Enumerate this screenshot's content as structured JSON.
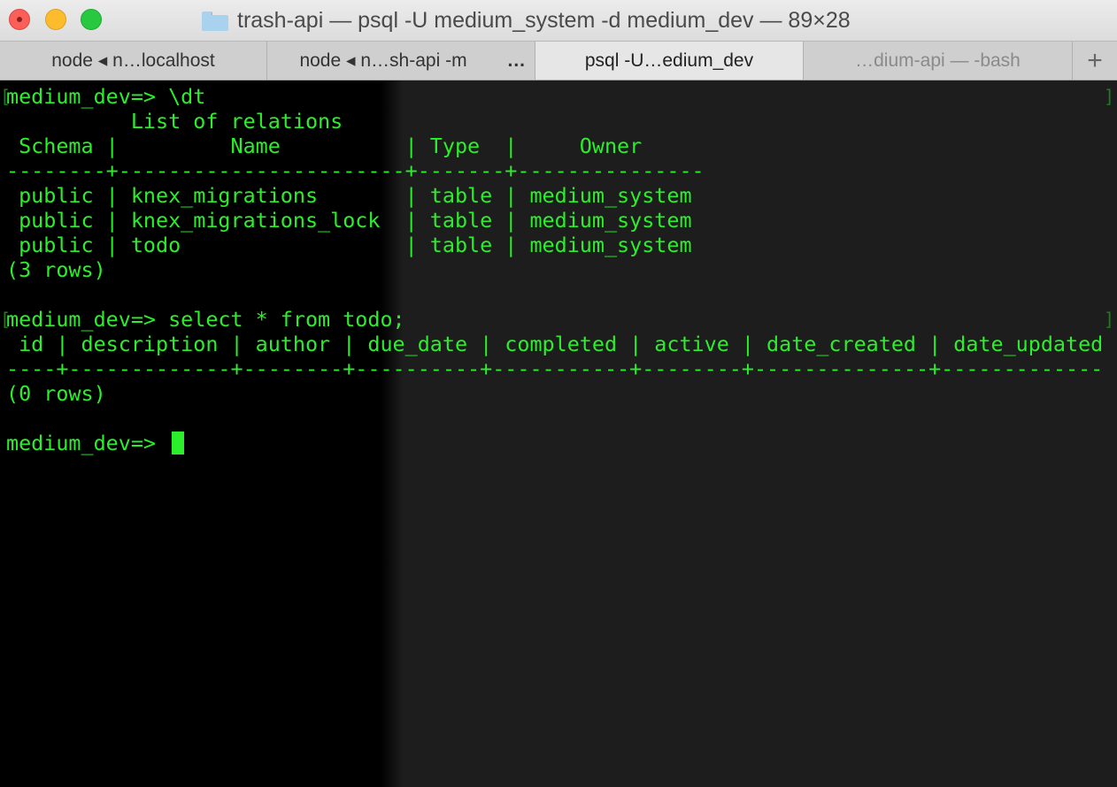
{
  "window": {
    "title": "trash-api — psql -U medium_system -d medium_dev — 89×28",
    "folder_icon": "folder-icon"
  },
  "tabs": [
    {
      "label": "node ◂ n…localhost"
    },
    {
      "label": "node ◂ n…sh-api -m",
      "more": "..."
    },
    {
      "label": "psql -U…edium_dev",
      "active": true
    },
    {
      "label": "…dium-api — -bash"
    }
  ],
  "new_tab_label": "+",
  "terminal": {
    "lines": [
      "medium_dev=> \\dt",
      "          List of relations",
      " Schema |         Name          | Type  |     Owner",
      "--------+-----------------------+-------+---------------",
      " public | knex_migrations       | table | medium_system",
      " public | knex_migrations_lock  | table | medium_system",
      " public | todo                  | table | medium_system",
      "(3 rows)",
      "",
      "medium_dev=> select * from todo;",
      " id | description | author | due_date | completed | active | date_created | date_updated",
      "----+-------------+--------+----------+-----------+--------+--------------+-------------",
      "(0 rows)",
      "",
      "medium_dev=> "
    ]
  },
  "colors": {
    "terminal_text": "#2bef2b",
    "close": "#fc5f57",
    "minimize": "#fdbc2e",
    "maximize": "#28c940"
  }
}
